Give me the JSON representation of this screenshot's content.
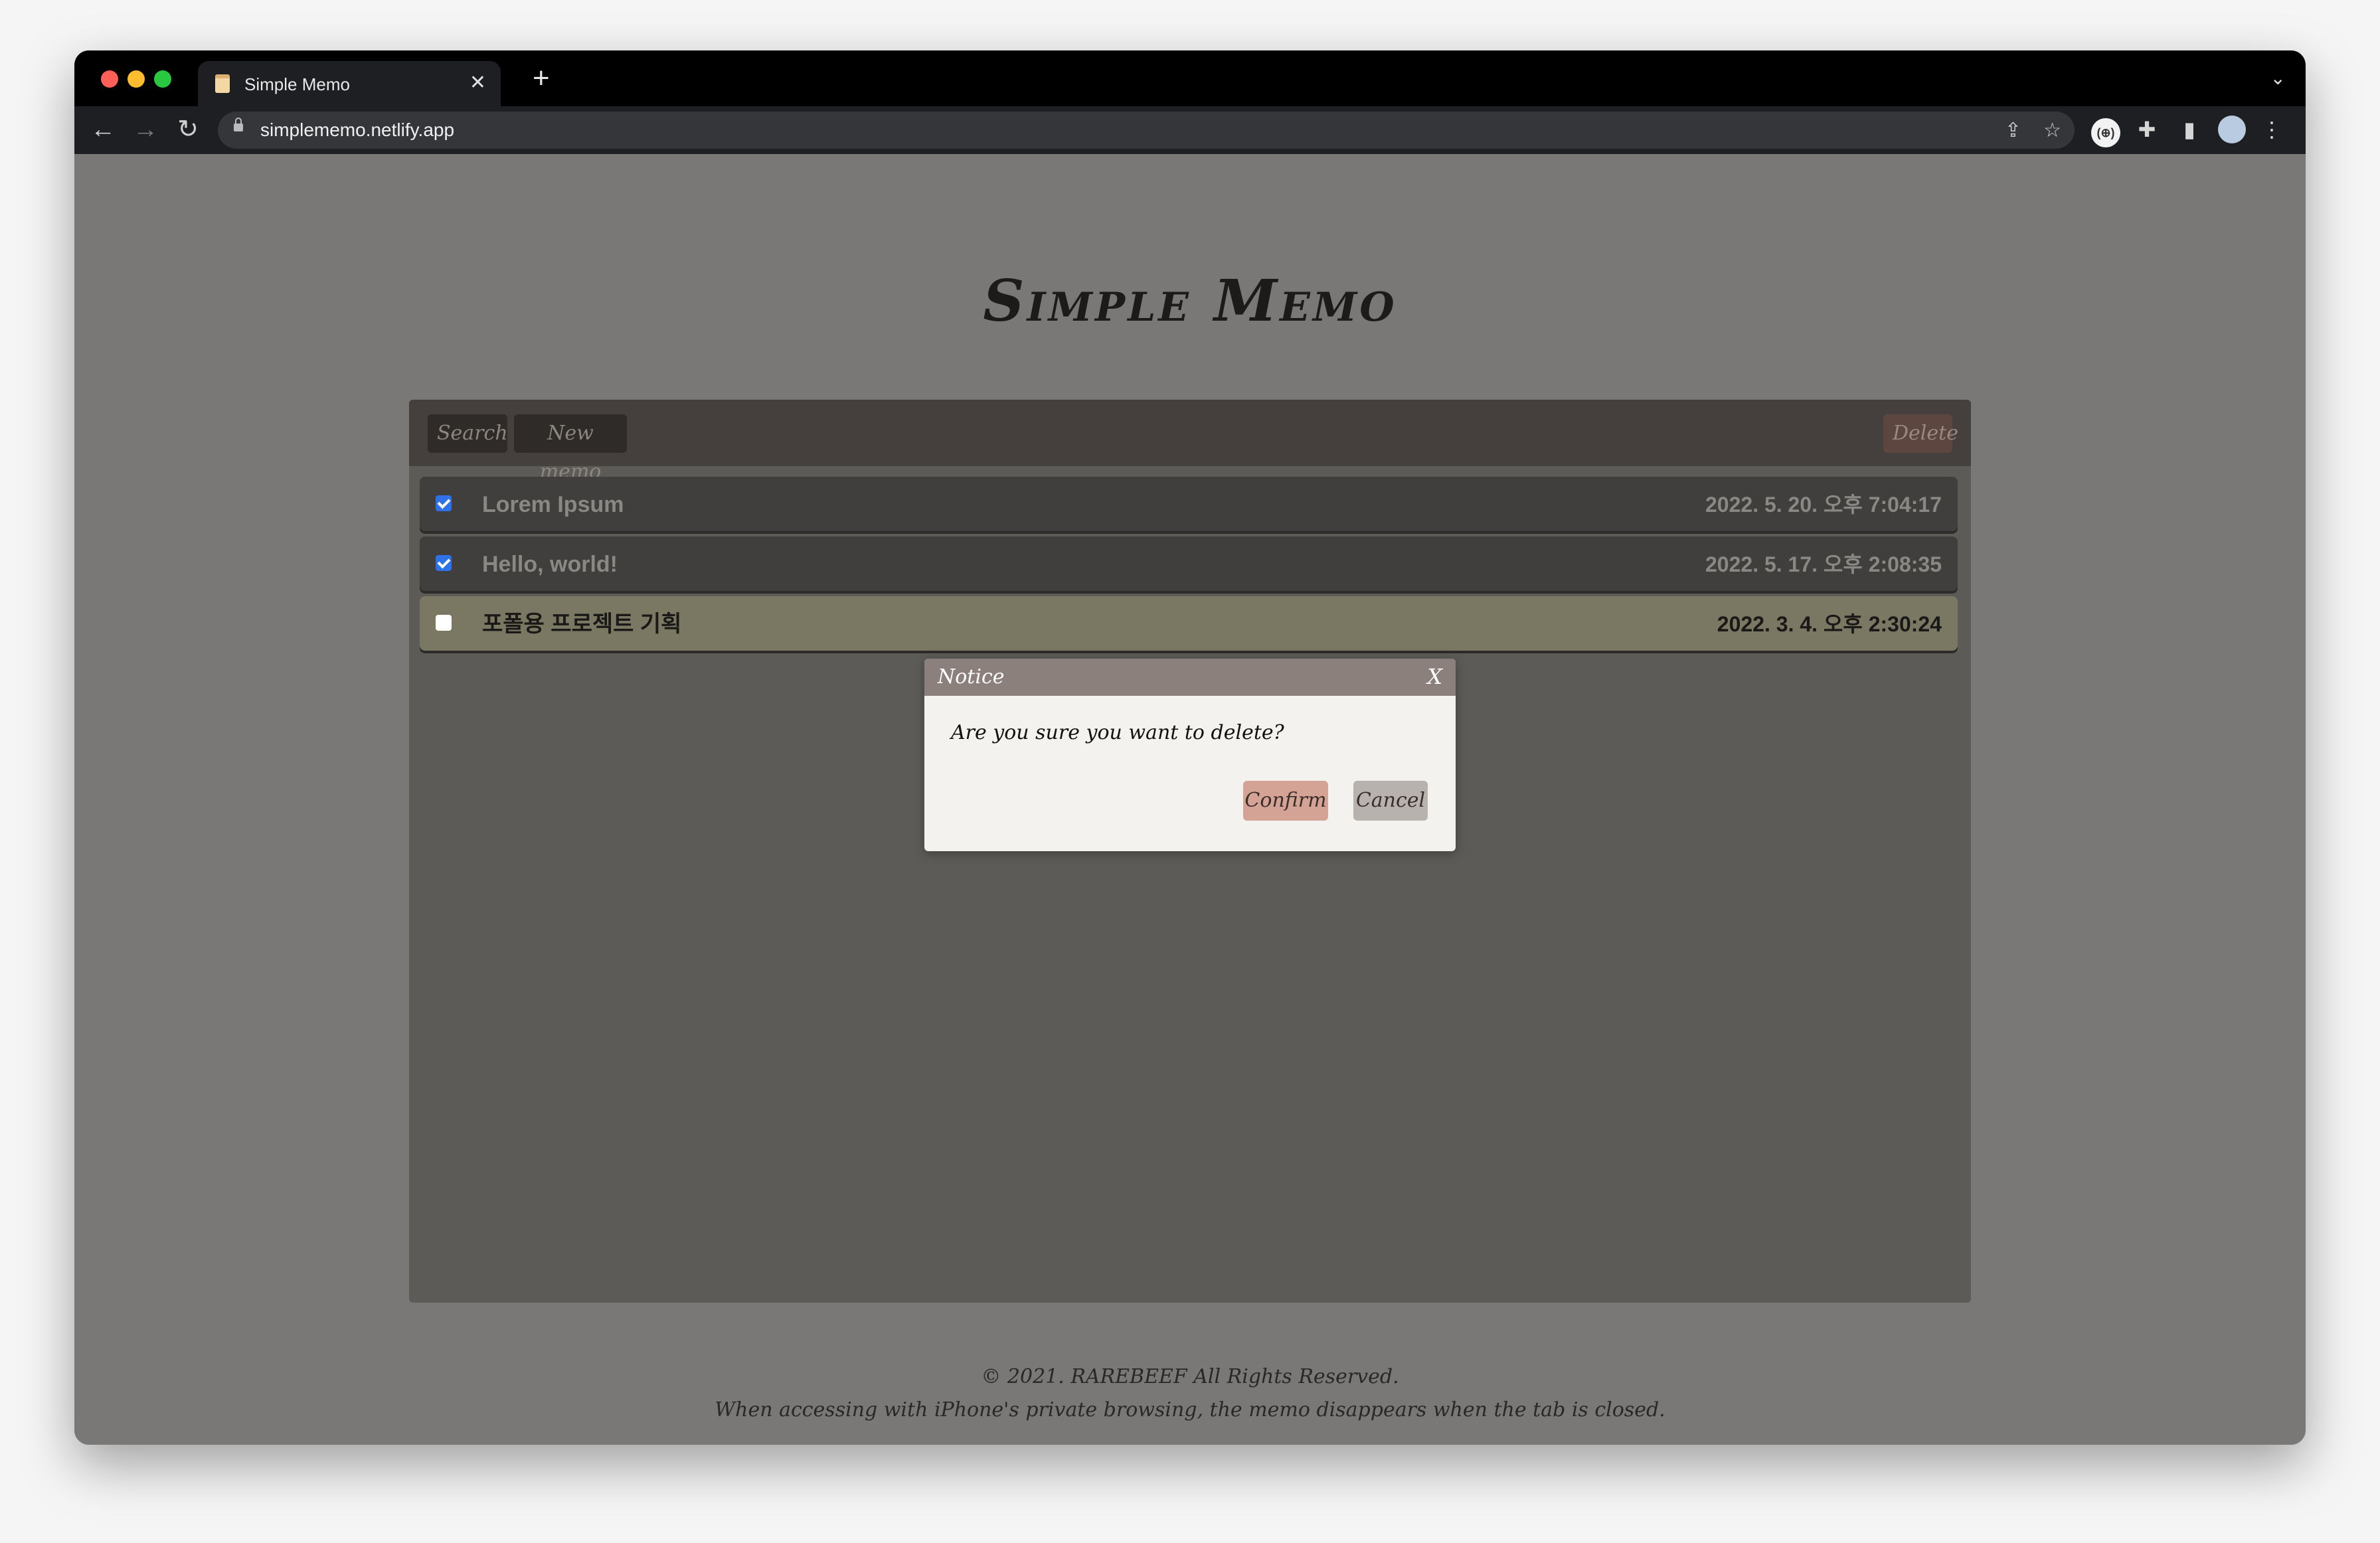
{
  "browser": {
    "tab_title": "Simple Memo",
    "tab_close": "✕",
    "new_tab": "+",
    "tab_menu": "⌄",
    "url": "simplememo.netlify.app",
    "icons": {
      "back": "←",
      "forward": "→",
      "reload": "↻",
      "share": "⇪",
      "star": "☆",
      "extension_badge": "(⊕)",
      "puzzle": "✚",
      "side_panel": "▮",
      "kebab": "⋮"
    }
  },
  "app": {
    "title": "Simple Memo",
    "toolbar": {
      "search_label": "Search",
      "new_memo_label": "New memo",
      "delete_label": "Delete"
    },
    "memos": [
      {
        "title": "Lorem Ipsum",
        "date": "2022. 5. 20. 오후 7:04:17",
        "checked": true
      },
      {
        "title": "Hello, world!",
        "date": "2022. 5. 17. 오후 2:08:35",
        "checked": true
      },
      {
        "title": "포폴용 프로젝트 기획",
        "date": "2022. 3. 4. 오후 2:30:24",
        "checked": false
      }
    ],
    "dialog": {
      "title": "Notice",
      "close_label": "X",
      "message": "Are you sure you want to delete?",
      "confirm_label": "Confirm",
      "cancel_label": "Cancel"
    },
    "footer": {
      "copyright": "© 2021. RAREBEEF All Rights Reserved.",
      "note": "When accessing with iPhone's private browsing, the memo disappears when the tab is closed."
    }
  },
  "colors": {
    "page_bg": "#7a7876",
    "panel_bg": "#5c5b58",
    "panel_header": "#45403d",
    "row_bg": "#403f3d",
    "row_selected": "#7a7762",
    "dialog_header": "#8b807c",
    "confirm_button": "#d4a395",
    "cancel_button": "#b7b2ae",
    "checkbox_checked": "#2f72e8"
  }
}
